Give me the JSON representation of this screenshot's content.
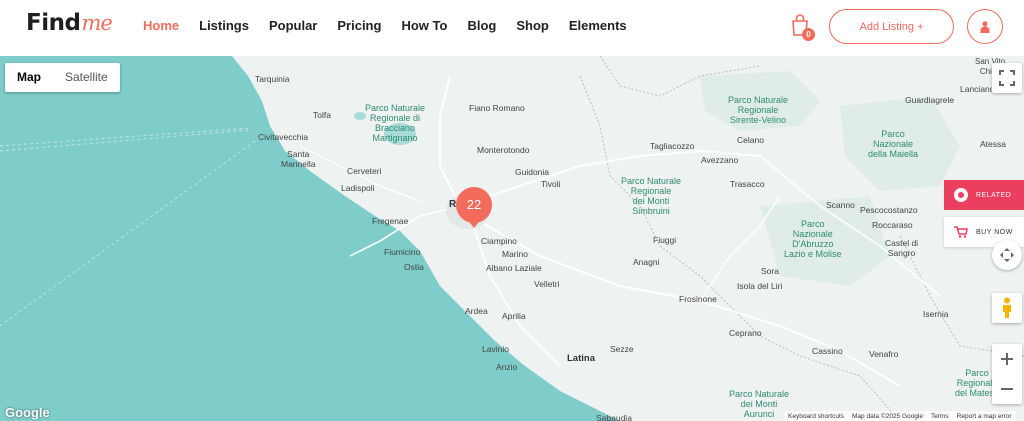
{
  "logo": {
    "main": "Find",
    "script": "me"
  },
  "nav": [
    "Home",
    "Listings",
    "Popular",
    "Pricing",
    "How To",
    "Blog",
    "Shop",
    "Elements"
  ],
  "header": {
    "cart_count": "0",
    "add_listing_label": "Add Listing +"
  },
  "map": {
    "type_map": "Map",
    "type_satellite": "Satellite",
    "cluster_count": "22",
    "labels": {
      "tarquinia": "Tarquinia",
      "tolfa": "Tolfa",
      "civitavecchia": "Civitavecchia",
      "santa_marinella": "Santa\nMarinella",
      "cerveteri": "Cerveteri",
      "ladispoli": "Ladispoli",
      "fregenae": "Fregenae",
      "fiumicino": "Fiumicino",
      "ostia": "Ostia",
      "fiano_romano": "Fiano Romano",
      "monterotondo": "Monterotondo",
      "guidonia": "Guidonia",
      "tivoli": "Tivoli",
      "ciampino": "Ciampino",
      "marino": "Marino",
      "albano": "Albano Laziale",
      "velletri": "Velletri",
      "ardea": "Ardea",
      "aprilia": "Aprilia",
      "lavinio": "Lavinio",
      "anzio": "Anzio",
      "latina": "Latina",
      "sezze": "Sezze",
      "sabaudia": "Sabaudia",
      "cepranto": "Ceprano",
      "frosinone": "Frosinone",
      "anagni": "Anagni",
      "fiuggi": "Fiuggi",
      "isola": "Isola del Liri",
      "sora": "Sora",
      "cassino": "Cassino",
      "venafro": "Venafro",
      "tagliacozzo": "Tagliacozzo",
      "avezzano": "Avezzano",
      "celano": "Celano",
      "trasacco": "Trasacco",
      "scanno": "Scanno",
      "pescocostanzo": "Pescocostanzo",
      "roccaraso": "Roccaraso",
      "castel": "Castel di\nSangro",
      "isernia": "Isernia",
      "atessa": "Atessa",
      "guardiagrele": "Guardiagrele",
      "lanciano": "Lanciano",
      "san_vito": "San Vito\nChieti",
      "rome_f": "R",
      "park_bracciano": "Parco Naturale\nRegionale di\nBracciano\nMartignano",
      "park_velino": "Parco Naturale\nRegionale\nSirente-Velino",
      "park_simbruini": "Parco Naturale\nRegionale\ndei Monti\nSimbruini",
      "park_maiella": "Parco\nNazionale\ndella Maiella",
      "park_abruzzo": "Parco\nNazionale\nD'Abruzzo\nLazio e Molise",
      "park_aurunci": "Parco Naturale\ndei Monti\nAurunci",
      "park_matese": "Parco\nRegionale\ndel Matese"
    },
    "google": "Google",
    "attribution": [
      "Keyboard shortcuts",
      "Map data ©2025 Google",
      "Terms",
      "Report a map error"
    ]
  },
  "side": {
    "related": "RELATED",
    "buy_now": "BUY NOW"
  },
  "colors": {
    "accent": "#f26b5b",
    "sea": "#7ecdcb",
    "park": "#2e8b6f",
    "related": "#ec3e5e"
  }
}
